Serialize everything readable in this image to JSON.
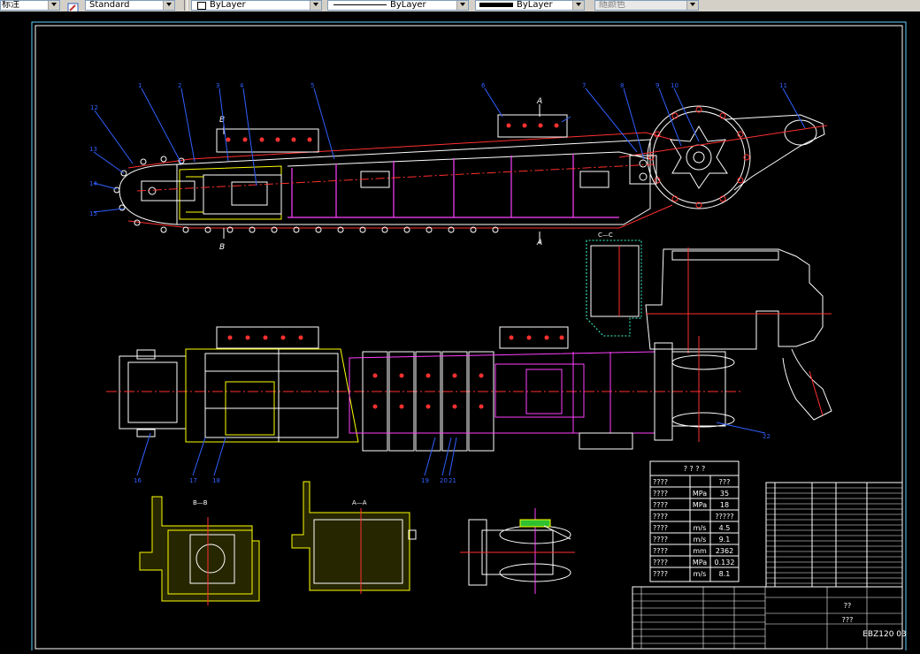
{
  "toolbar": {
    "annotation_style": "标注",
    "text_style": "Standard",
    "layer_color": "ByLayer",
    "linetype": "ByLayer",
    "lineweight": "ByLayer",
    "plot_style": "随颜色"
  },
  "drawing": {
    "section_labels": {
      "b1": "B",
      "b2": "B",
      "a1": "A",
      "a2": "A",
      "cc": "C—C",
      "section_bb": "B—B",
      "section_aa": "A—A"
    },
    "part_numbers_top": [
      "1",
      "2",
      "3",
      "4",
      "5",
      "6",
      "7",
      "8",
      "9",
      "10",
      "11"
    ],
    "params_table": {
      "title": "? ? ? ?",
      "rows": [
        {
          "name": "????",
          "unit": "",
          "value": "???"
        },
        {
          "name": "????",
          "unit": "MPa",
          "value": "35"
        },
        {
          "name": "????",
          "unit": "MPa",
          "value": "18"
        },
        {
          "name": "????",
          "unit": "",
          "value": "?????"
        },
        {
          "name": "????",
          "unit": "m/s",
          "value": "4.5"
        },
        {
          "name": "????",
          "unit": "m/s",
          "value": "9.1"
        },
        {
          "name": "????",
          "unit": "mm",
          "value": "2362"
        },
        {
          "name": "????",
          "unit": "MPa",
          "value": "0.132"
        },
        {
          "name": "????",
          "unit": "m/s",
          "value": "8.1"
        }
      ]
    },
    "title_block": {
      "drawing_no": "EBZ120 03",
      "name": "???",
      "company": "??"
    }
  }
}
